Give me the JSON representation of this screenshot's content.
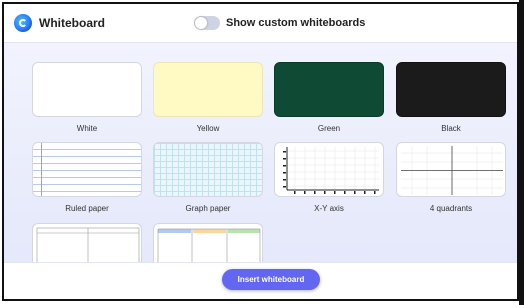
{
  "header": {
    "title": "Whiteboard",
    "toggle_label": "Show custom whiteboards",
    "toggle_on": false
  },
  "boards": [
    {
      "label": "White",
      "color": "#ffffff"
    },
    {
      "label": "Yellow",
      "color": "#fff9c4"
    },
    {
      "label": "Green",
      "color": "#0e4a34"
    },
    {
      "label": "Black",
      "color": "#1b1b1b"
    },
    {
      "label": "Ruled paper",
      "color": "#ffffff"
    },
    {
      "label": "Graph paper",
      "color": "#eaf6fb"
    },
    {
      "label": "X-Y axis",
      "color": "#ffffff"
    },
    {
      "label": "4 quadrants",
      "color": "#ffffff"
    }
  ],
  "footer": {
    "insert_label": "Insert whiteboard",
    "accent": "#6366f1"
  }
}
